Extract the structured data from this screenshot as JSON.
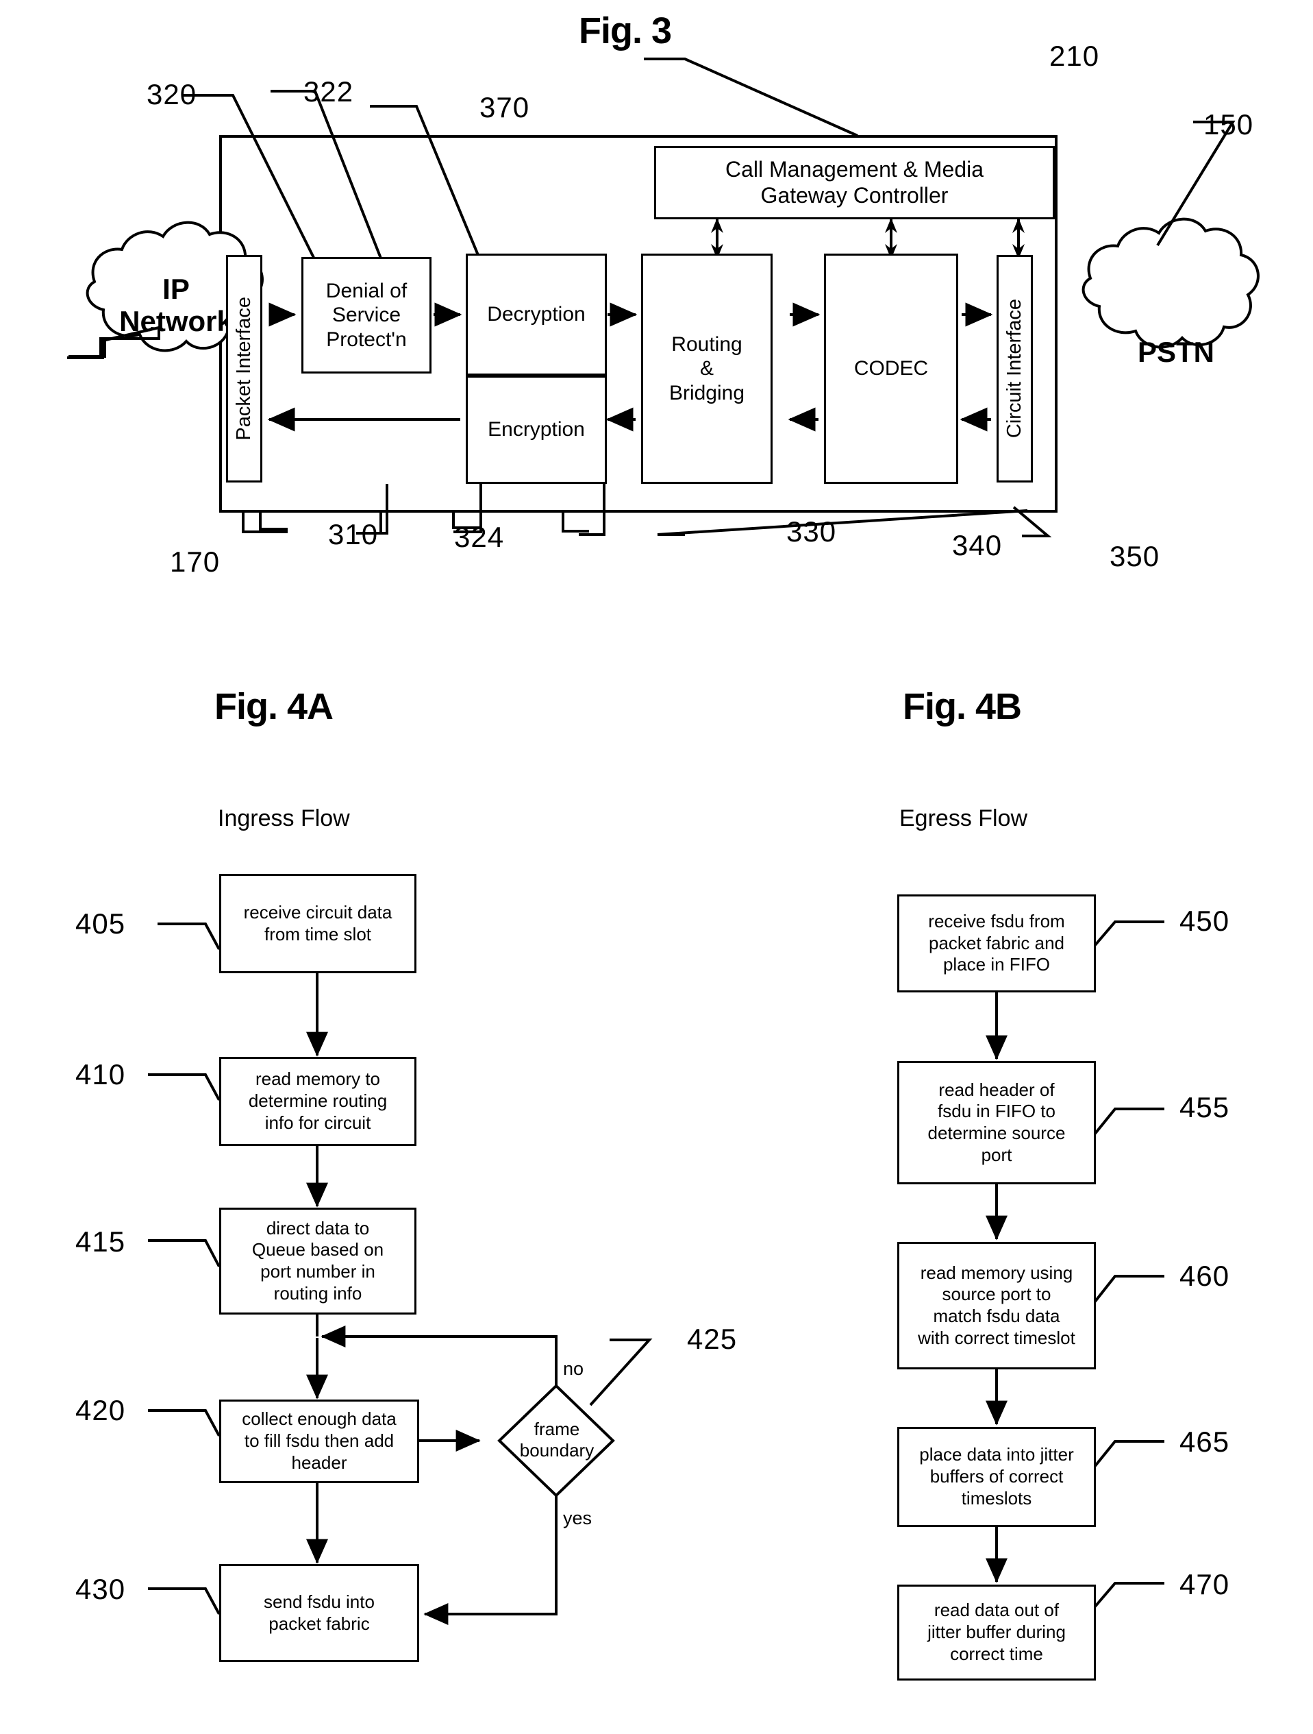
{
  "figures": {
    "fig3": {
      "title": "Fig. 3",
      "outer_box_ref": "210",
      "blocks": {
        "ip_network": "IP\nNetwork",
        "ip_network_line1": "IP",
        "ip_network_line2": "Network",
        "packet_interface": "Packet Interface",
        "dos_protection_line1": "Denial of",
        "dos_protection_line2": "Service",
        "dos_protection_line3": "Protect'n",
        "decryption": "Decryption",
        "encryption": "Encryption",
        "routing_line1": "Routing",
        "routing_line2": "&",
        "routing_line3": "Bridging",
        "codec": "CODEC",
        "circuit_interface": "Circuit Interface",
        "call_manager_line1": "Call Management & Media",
        "call_manager_line2": "Gateway Controller",
        "pstn": "PSTN"
      },
      "refs": {
        "r320": "320",
        "r322": "322",
        "r370": "370",
        "r210": "210",
        "r150": "150",
        "r170": "170",
        "r310": "310",
        "r324": "324",
        "r330": "330",
        "r340": "340",
        "r350": "350"
      }
    },
    "fig4a": {
      "title": "Fig. 4A",
      "subtitle": "Ingress Flow",
      "steps": [
        {
          "ref": "405",
          "text": "receive circuit data\nfrom time slot",
          "lines": [
            "receive circuit data",
            "from time slot"
          ]
        },
        {
          "ref": "410",
          "text": "read memory to\ndetermine routing\ninfo for circuit",
          "lines": [
            "read memory to",
            "determine routing",
            "info for circuit"
          ]
        },
        {
          "ref": "415",
          "text": "direct data to\nQueue based on\nport number in\nrouting  info",
          "lines": [
            "direct data to",
            "Queue based on",
            "port number in",
            "routing  info"
          ]
        },
        {
          "ref": "420",
          "text": "collect enough data\nto fill fsdu then add\nheader",
          "lines": [
            "collect enough data",
            "to fill fsdu then add",
            "header"
          ]
        },
        {
          "ref": "430",
          "text": "send fsdu into\npacket fabric",
          "lines": [
            "send fsdu into",
            "packet fabric"
          ]
        }
      ],
      "decision": {
        "ref": "425",
        "lines": [
          "frame",
          "boundary"
        ],
        "branch_no": "no",
        "branch_yes": "yes"
      }
    },
    "fig4b": {
      "title": "Fig. 4B",
      "subtitle": "Egress Flow",
      "steps": [
        {
          "ref": "450",
          "text": "receive fsdu from\npacket fabric and\nplace in FIFO",
          "lines": [
            "receive fsdu from",
            "packet fabric and",
            "place in FIFO"
          ]
        },
        {
          "ref": "455",
          "text": "read header  of\nfsdu in FIFO to\ndetermine source\nport",
          "lines": [
            "read header  of",
            "fsdu in FIFO to",
            "determine source",
            "port"
          ]
        },
        {
          "ref": "460",
          "text": "read memory using\nsource port to\nmatch fsdu data\nwith correct timeslot",
          "lines": [
            "read memory using",
            "source port to",
            "match fsdu data",
            "with correct timeslot"
          ]
        },
        {
          "ref": "465",
          "text": "place data into jitter\nbuffers of correct\ntimeslots",
          "lines": [
            "place data into jitter",
            "buffers of correct",
            "timeslots"
          ]
        },
        {
          "ref": "470",
          "text": "read data out of\njitter buffer during\ncorrect time",
          "lines": [
            "read data out of",
            "jitter buffer during",
            "correct time"
          ]
        }
      ]
    }
  },
  "colors": {
    "ink": "#000000",
    "paper": "#ffffff"
  }
}
